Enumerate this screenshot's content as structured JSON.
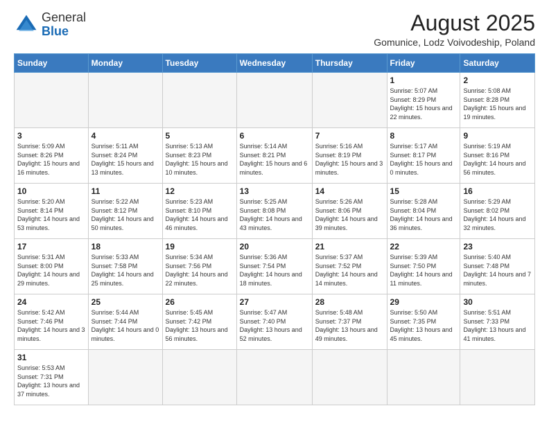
{
  "header": {
    "logo_general": "General",
    "logo_blue": "Blue",
    "title": "August 2025",
    "subtitle": "Gomunice, Lodz Voivodeship, Poland"
  },
  "weekdays": [
    "Sunday",
    "Monday",
    "Tuesday",
    "Wednesday",
    "Thursday",
    "Friday",
    "Saturday"
  ],
  "weeks": [
    [
      {
        "day": "",
        "info": ""
      },
      {
        "day": "",
        "info": ""
      },
      {
        "day": "",
        "info": ""
      },
      {
        "day": "",
        "info": ""
      },
      {
        "day": "",
        "info": ""
      },
      {
        "day": "1",
        "info": "Sunrise: 5:07 AM\nSunset: 8:29 PM\nDaylight: 15 hours\nand 22 minutes."
      },
      {
        "day": "2",
        "info": "Sunrise: 5:08 AM\nSunset: 8:28 PM\nDaylight: 15 hours\nand 19 minutes."
      }
    ],
    [
      {
        "day": "3",
        "info": "Sunrise: 5:09 AM\nSunset: 8:26 PM\nDaylight: 15 hours\nand 16 minutes."
      },
      {
        "day": "4",
        "info": "Sunrise: 5:11 AM\nSunset: 8:24 PM\nDaylight: 15 hours\nand 13 minutes."
      },
      {
        "day": "5",
        "info": "Sunrise: 5:13 AM\nSunset: 8:23 PM\nDaylight: 15 hours\nand 10 minutes."
      },
      {
        "day": "6",
        "info": "Sunrise: 5:14 AM\nSunset: 8:21 PM\nDaylight: 15 hours\nand 6 minutes."
      },
      {
        "day": "7",
        "info": "Sunrise: 5:16 AM\nSunset: 8:19 PM\nDaylight: 15 hours\nand 3 minutes."
      },
      {
        "day": "8",
        "info": "Sunrise: 5:17 AM\nSunset: 8:17 PM\nDaylight: 15 hours\nand 0 minutes."
      },
      {
        "day": "9",
        "info": "Sunrise: 5:19 AM\nSunset: 8:16 PM\nDaylight: 14 hours\nand 56 minutes."
      }
    ],
    [
      {
        "day": "10",
        "info": "Sunrise: 5:20 AM\nSunset: 8:14 PM\nDaylight: 14 hours\nand 53 minutes."
      },
      {
        "day": "11",
        "info": "Sunrise: 5:22 AM\nSunset: 8:12 PM\nDaylight: 14 hours\nand 50 minutes."
      },
      {
        "day": "12",
        "info": "Sunrise: 5:23 AM\nSunset: 8:10 PM\nDaylight: 14 hours\nand 46 minutes."
      },
      {
        "day": "13",
        "info": "Sunrise: 5:25 AM\nSunset: 8:08 PM\nDaylight: 14 hours\nand 43 minutes."
      },
      {
        "day": "14",
        "info": "Sunrise: 5:26 AM\nSunset: 8:06 PM\nDaylight: 14 hours\nand 39 minutes."
      },
      {
        "day": "15",
        "info": "Sunrise: 5:28 AM\nSunset: 8:04 PM\nDaylight: 14 hours\nand 36 minutes."
      },
      {
        "day": "16",
        "info": "Sunrise: 5:29 AM\nSunset: 8:02 PM\nDaylight: 14 hours\nand 32 minutes."
      }
    ],
    [
      {
        "day": "17",
        "info": "Sunrise: 5:31 AM\nSunset: 8:00 PM\nDaylight: 14 hours\nand 29 minutes."
      },
      {
        "day": "18",
        "info": "Sunrise: 5:33 AM\nSunset: 7:58 PM\nDaylight: 14 hours\nand 25 minutes."
      },
      {
        "day": "19",
        "info": "Sunrise: 5:34 AM\nSunset: 7:56 PM\nDaylight: 14 hours\nand 22 minutes."
      },
      {
        "day": "20",
        "info": "Sunrise: 5:36 AM\nSunset: 7:54 PM\nDaylight: 14 hours\nand 18 minutes."
      },
      {
        "day": "21",
        "info": "Sunrise: 5:37 AM\nSunset: 7:52 PM\nDaylight: 14 hours\nand 14 minutes."
      },
      {
        "day": "22",
        "info": "Sunrise: 5:39 AM\nSunset: 7:50 PM\nDaylight: 14 hours\nand 11 minutes."
      },
      {
        "day": "23",
        "info": "Sunrise: 5:40 AM\nSunset: 7:48 PM\nDaylight: 14 hours\nand 7 minutes."
      }
    ],
    [
      {
        "day": "24",
        "info": "Sunrise: 5:42 AM\nSunset: 7:46 PM\nDaylight: 14 hours\nand 3 minutes."
      },
      {
        "day": "25",
        "info": "Sunrise: 5:44 AM\nSunset: 7:44 PM\nDaylight: 14 hours\nand 0 minutes."
      },
      {
        "day": "26",
        "info": "Sunrise: 5:45 AM\nSunset: 7:42 PM\nDaylight: 13 hours\nand 56 minutes."
      },
      {
        "day": "27",
        "info": "Sunrise: 5:47 AM\nSunset: 7:40 PM\nDaylight: 13 hours\nand 52 minutes."
      },
      {
        "day": "28",
        "info": "Sunrise: 5:48 AM\nSunset: 7:37 PM\nDaylight: 13 hours\nand 49 minutes."
      },
      {
        "day": "29",
        "info": "Sunrise: 5:50 AM\nSunset: 7:35 PM\nDaylight: 13 hours\nand 45 minutes."
      },
      {
        "day": "30",
        "info": "Sunrise: 5:51 AM\nSunset: 7:33 PM\nDaylight: 13 hours\nand 41 minutes."
      }
    ],
    [
      {
        "day": "31",
        "info": "Sunrise: 5:53 AM\nSunset: 7:31 PM\nDaylight: 13 hours\nand 37 minutes."
      },
      {
        "day": "",
        "info": ""
      },
      {
        "day": "",
        "info": ""
      },
      {
        "day": "",
        "info": ""
      },
      {
        "day": "",
        "info": ""
      },
      {
        "day": "",
        "info": ""
      },
      {
        "day": "",
        "info": ""
      }
    ]
  ]
}
